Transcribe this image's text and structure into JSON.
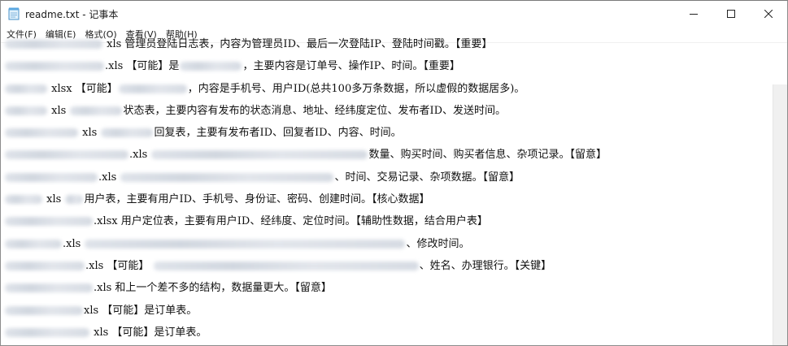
{
  "window": {
    "title": "readme.txt - 记事本"
  },
  "menu": {
    "items": [
      "文件(F)",
      "编辑(E)",
      "格式(O)",
      "查看(V)",
      "帮助(H)"
    ]
  },
  "lines": [
    "xls 管理员登陆日志表，内容为管理员ID、最后一次登陆IP、登陆时间戳。【重要】",
    ".xls 【可能】是",
    "，主要内容是订单号、操作IP、时间。【重要】",
    "xlsx 【可能】",
    "，内容是手机号、用户ID(总共100多万条数据，所以虚假的数据居多)。",
    "xls",
    "状态表，主要内容有发布的状态消息、地址、经纬度定位、发布者ID、发送时间。",
    "xls",
    "回复表，主要有发布者ID、回复者ID、内容、时间。",
    ".xls",
    "数量、购买时间、购买者信息、杂项记录。【留意】",
    ".xls",
    "、时间、交易记录、杂项数据。【留意】",
    "xls",
    "用户表，主要有用户ID、手机号、身份证、密码、创建时间。【核心数据】",
    ".xlsx 用户定位表，主要有用户ID、经纬度、定位时间。【辅助性数据，结合用户表】",
    ".xls",
    "、修改时间。",
    ".xls 【可能】",
    "、姓名、办理银行。【关键】",
    ".xls 和上一个差不多的结构，数据量更大。【留意】",
    "xls 【可能】是订单表。",
    "xls 【可能】是订单表。"
  ]
}
